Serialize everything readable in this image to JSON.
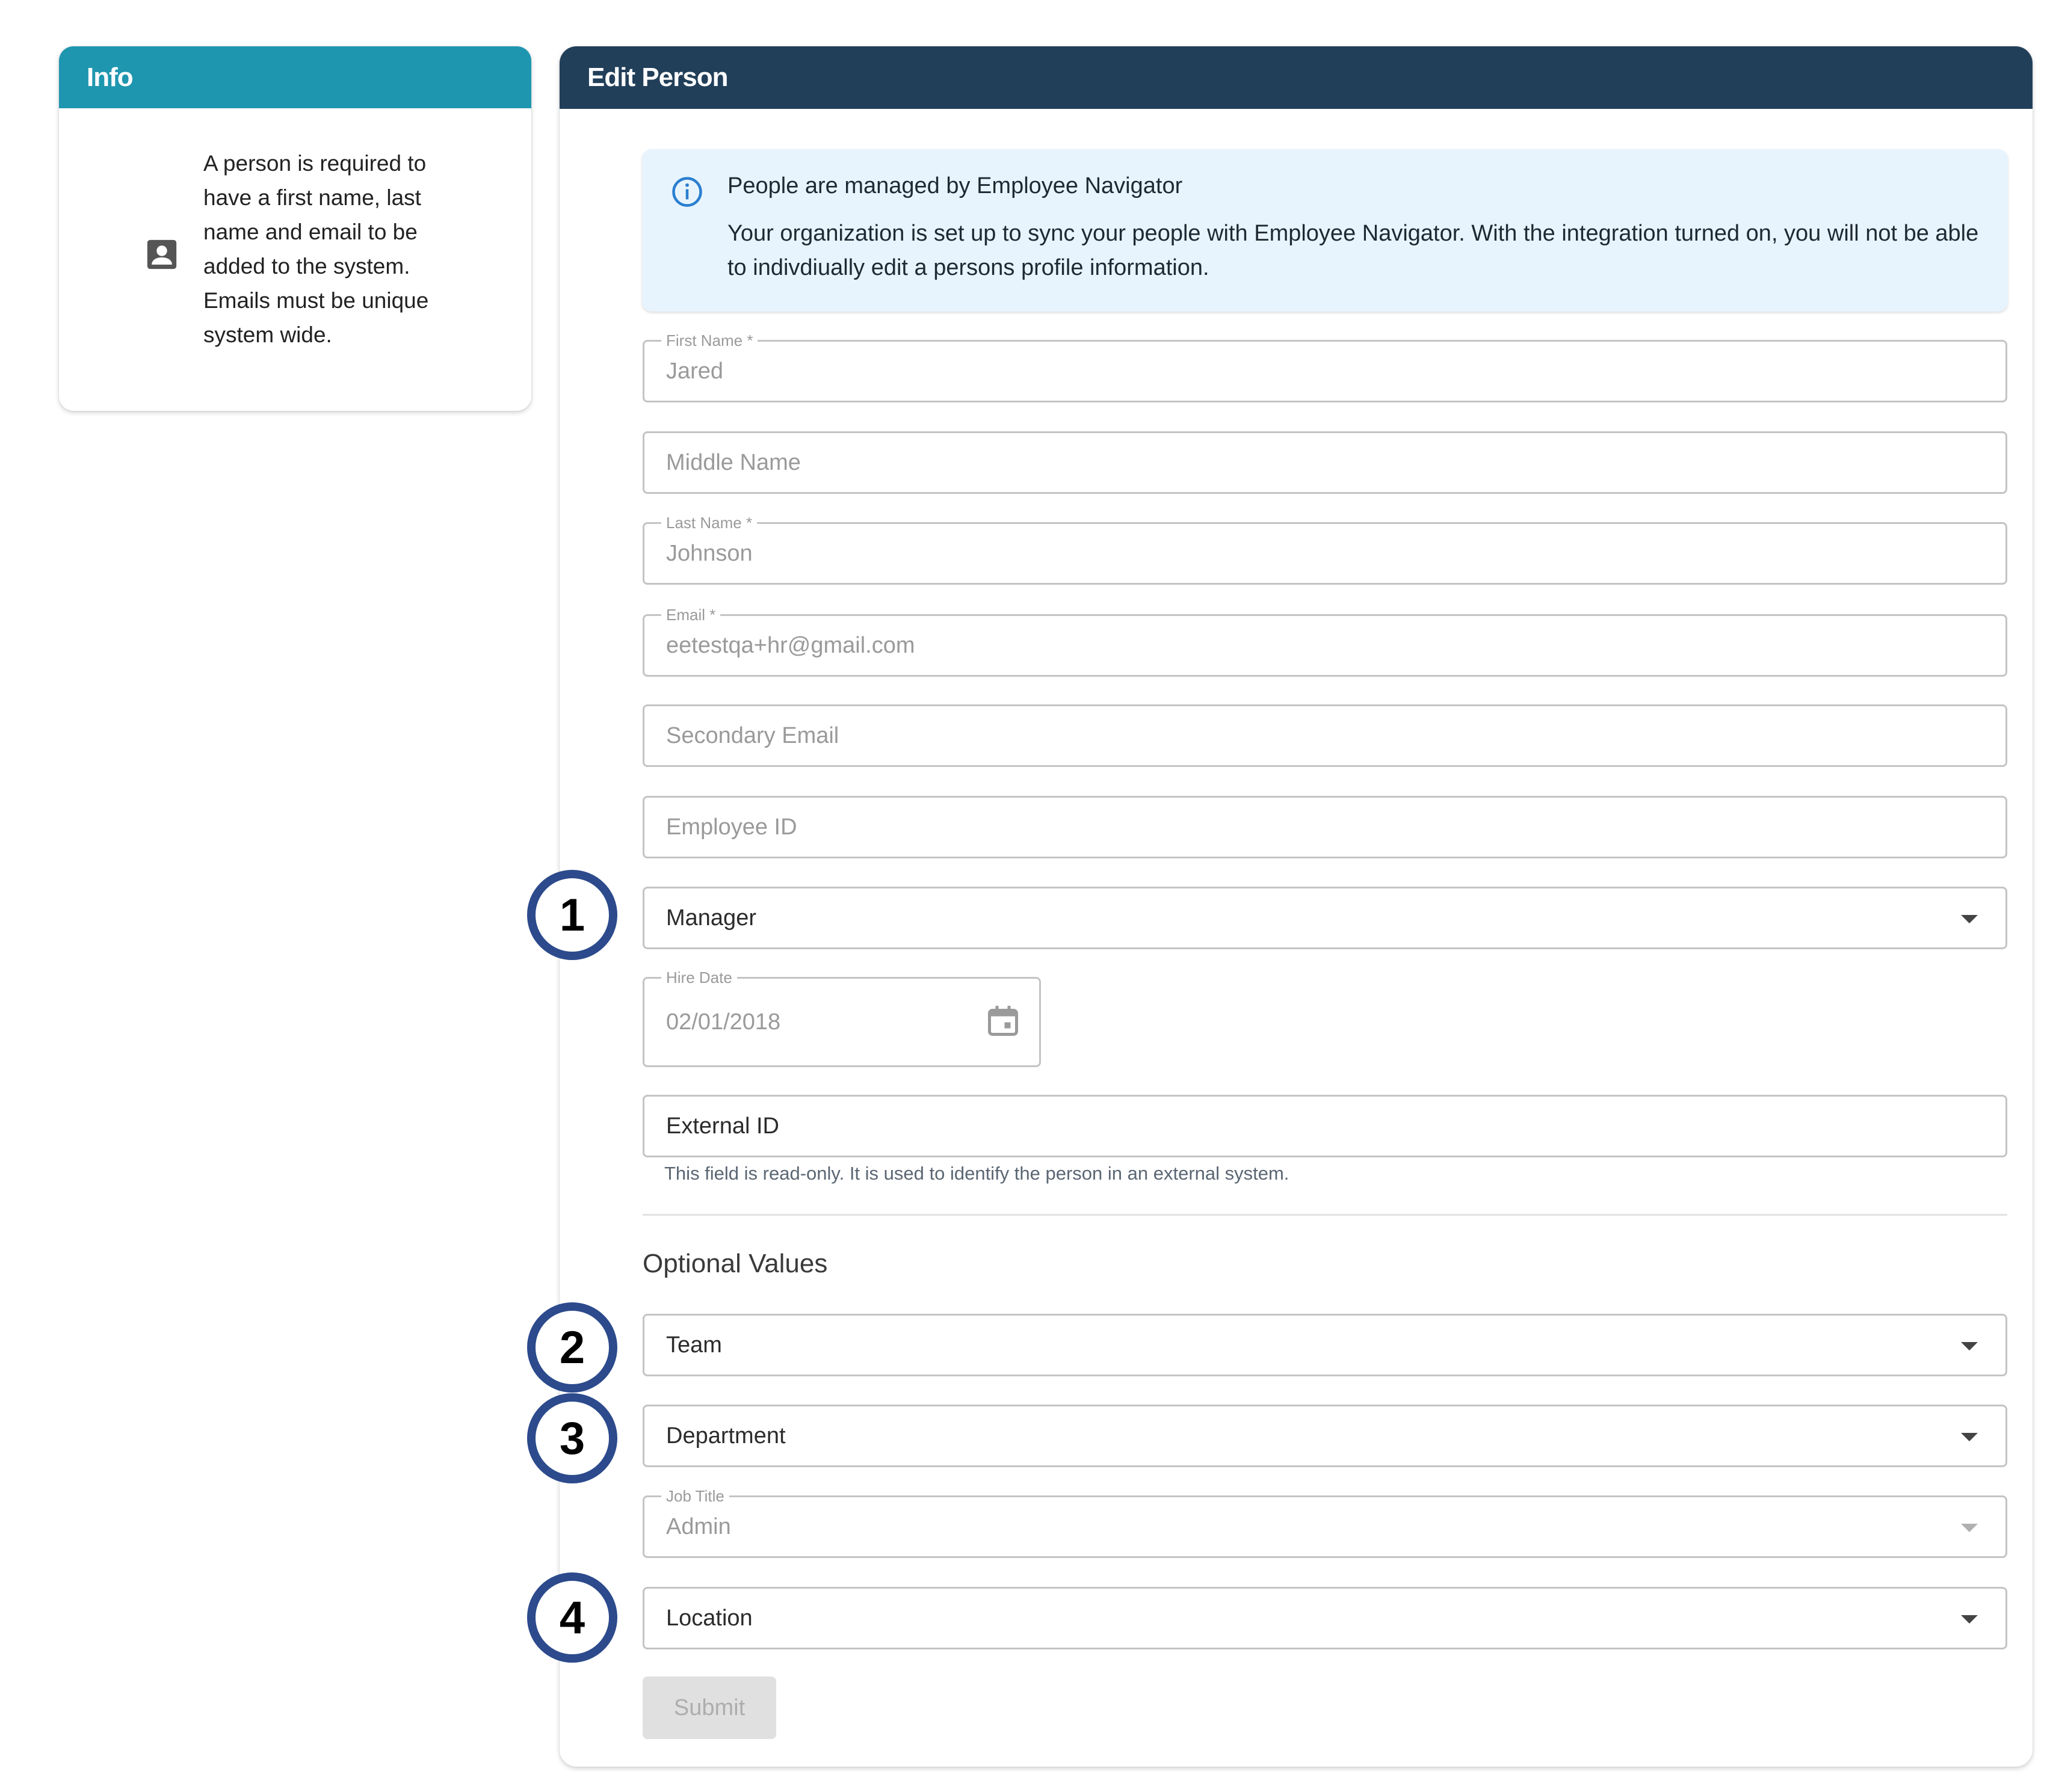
{
  "info": {
    "title": "Info",
    "icon": "person-badge-icon",
    "lines": [
      "A person is required to",
      "have a first name, last",
      "name and email to be",
      "added to the system.",
      "Emails must be unique",
      "system wide."
    ]
  },
  "edit": {
    "title": "Edit Person",
    "alert": {
      "icon": "info-circle-icon",
      "title": "People are managed by Employee Navigator",
      "body": "Your organization is set up to sync your people with Employee Navigator. With the integration turned on, you will not be able to indivdiually edit a persons profile information."
    },
    "fields": {
      "first_name": {
        "label": "First Name *",
        "value": "Jared"
      },
      "middle_name": {
        "placeholder": "Middle Name"
      },
      "last_name": {
        "label": "Last Name *",
        "value": "Johnson"
      },
      "email": {
        "label": "Email *",
        "value": "eetestqa+hr@gmail.com"
      },
      "secondary_email": {
        "placeholder": "Secondary Email"
      },
      "employee_id": {
        "placeholder": "Employee ID"
      },
      "manager": {
        "placeholder": "Manager"
      },
      "hire_date": {
        "label": "Hire Date",
        "value": "02/01/2018"
      },
      "external_id": {
        "placeholder": "External ID",
        "helper": "This field is read-only. It is used to identify the person in an external system."
      }
    },
    "optional_title": "Optional Values",
    "optional": {
      "team": {
        "placeholder": "Team"
      },
      "department": {
        "placeholder": "Department"
      },
      "job_title": {
        "label": "Job Title",
        "value": "Admin"
      },
      "location": {
        "placeholder": "Location"
      }
    },
    "submit_label": "Submit"
  },
  "markers": [
    "1",
    "2",
    "3",
    "4"
  ],
  "colors": {
    "info_header": "#1f96b0",
    "edit_header": "#223f59",
    "alert_bg": "#e8f4fd",
    "marker_ring": "#2c4a8c"
  }
}
